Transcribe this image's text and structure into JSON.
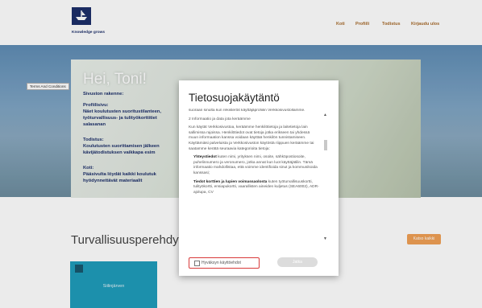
{
  "header": {
    "brand_tagline": "Knowledge grows",
    "nav": [
      "Koti",
      "Profiili",
      "Todistus",
      "Kirjaudu ulos"
    ]
  },
  "hero": {
    "greeting": "Hei, Toni!",
    "intro_heading": "Sivuston rakenne:",
    "profile_heading": "Profiilisivu:",
    "profile_text": "Näet koulutusten suoritustilanteen, työturvallisuus- ja tulityökorttitiet salasanan",
    "certificate_heading": "Todistus:",
    "certificate_text": "Koulutusten suorittamisen jälkeen kävijätodistuksen vaikkapa esim",
    "home_heading": "Koti:",
    "home_text": "Pääsivulta löydät kaikki koulutuk hyödynnettävät materiaalit",
    "terms_tab_label": "Terms And Conditions"
  },
  "section": {
    "title": "Turvallisuusperehdyt",
    "orange_button_label": "Katso kaikki",
    "card_text": "Siilinjärven"
  },
  "modal": {
    "title": "Tietosuojakäytäntö",
    "para1": "suoraan sinulta kun rekisteröit käyttäjäprofiilin Verkkosivustollamme.",
    "para2": "2 Informaatio ja data jota keräämme",
    "para3": "Kun käytät Verkkosivustoa, keräämme henkilötietoja ja laitetietoja lain sallimissa rajoissa. Henkilötiedot ovat tietoja jotka erikseen tai yhdessä muun informaation kanssa voidaan käyttää henkilön tunnistamiseen. Käyttämiäsi palveluista ja Verkkosivuston käytöstä riippuen keräämme tai saatamme kerätä seuraavia kategorioita tietoja:",
    "bullet1_bold": "Yhteystiedot",
    "bullet1_text": "kuten nimi, yrityksen nimi, osoite, sähköpostiosoite, puhelinnumero ja veronumero, jotka annat kun luot käyttäjätilin. Tämä informaatio mahdollistaa, että voimme identifioida sinut ja kommunikoida kanssasi;",
    "bullet2_bold": "Tiedot korttien ja lupien voimassaolosta",
    "bullet2_text": "kuten työturvallisuuskortti, tulityökortti, ensiapukortti, vaarallisten aineiden kuljetus (SEA6002), ADR-ajolupa, CV",
    "accept_label": "Hyväksyn käyttöehdot",
    "continue_label": "Jatka"
  },
  "colors": {
    "brand_navy": "#1d2f6a",
    "nav_orange": "#a86b2b",
    "accent_orange": "#f0a055",
    "card_teal": "#1f9dbb",
    "highlight_red": "#d83a3a"
  },
  "icons": {
    "logo": "yara-ship-logo-icon",
    "scroll_up": "scroll-up-arrow-icon",
    "scroll_down": "scroll-down-arrow-icon"
  }
}
